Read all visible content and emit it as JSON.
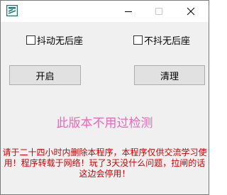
{
  "window": {
    "title": ""
  },
  "title_buttons": {
    "minimize_icon": "minimize-icon",
    "maximize_icon": "maximize-icon",
    "close_icon": "close-icon"
  },
  "options": {
    "shake_no_recoil": {
      "label": "抖动无后座",
      "checked": false
    },
    "no_shake_no_recoil": {
      "label": "不抖无后座",
      "checked": false
    }
  },
  "actions": {
    "start_label": "开启",
    "clear_label": "清理"
  },
  "messages": {
    "notice": "此版本不用过检测",
    "warning": "请于二十四小时内删除本程序，本程序仅供交流学习使用！程序转载于网络！玩了3天没什么问题，拉闸的话这边会停用！"
  },
  "colors": {
    "notice": "#e56bb5",
    "warning": "#d10000",
    "background": "#f0f0f0",
    "button": "#e1e1e1",
    "icon": "#1c7a73"
  }
}
